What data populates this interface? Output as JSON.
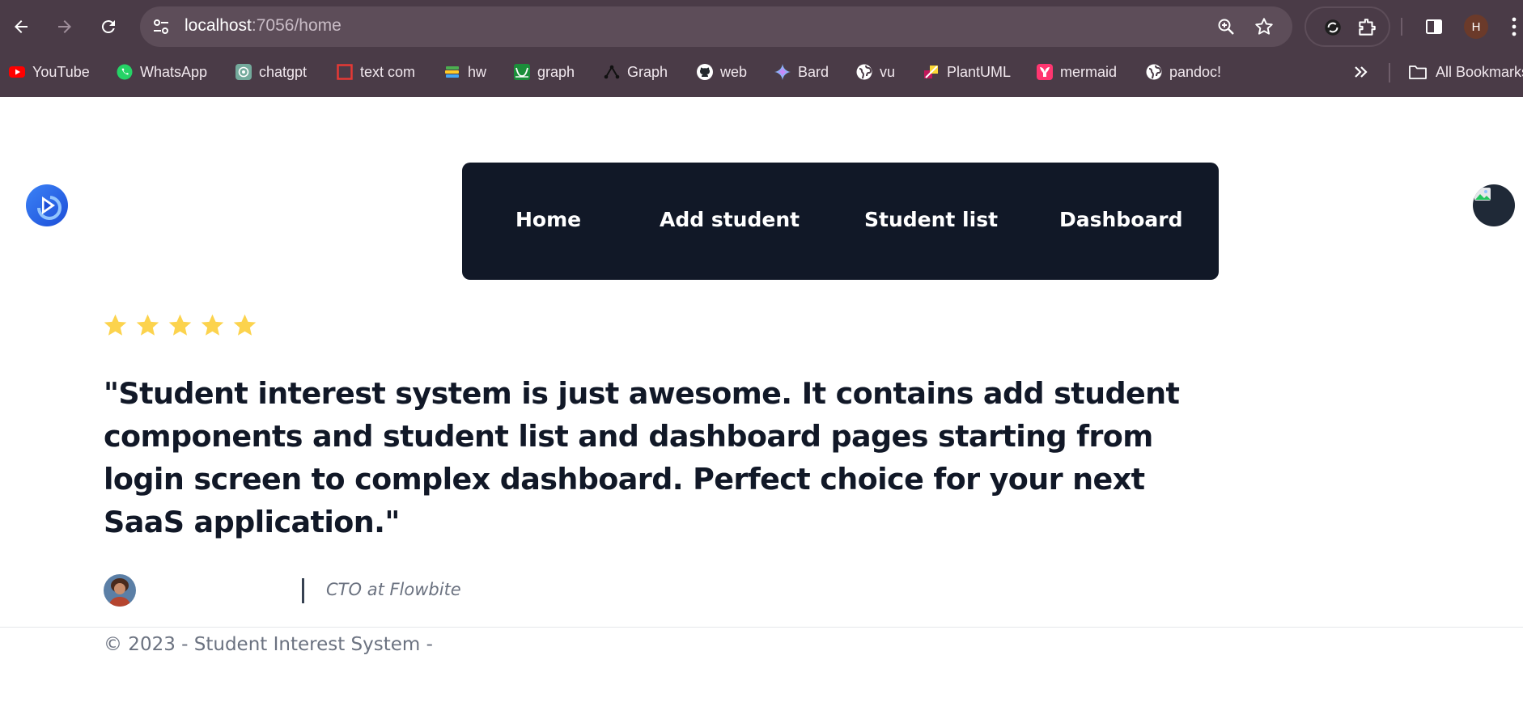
{
  "browser": {
    "url_host": "localhost",
    "url_path": ":7056/home",
    "profile_initial": "H",
    "bookmarks": [
      {
        "label": "YouTube",
        "icon": "youtube-icon"
      },
      {
        "label": "WhatsApp",
        "icon": "whatsapp-icon"
      },
      {
        "label": "chatgpt",
        "icon": "chatgpt-icon"
      },
      {
        "label": "text com",
        "icon": "square-icon"
      },
      {
        "label": "hw",
        "icon": "books-icon"
      },
      {
        "label": "graph",
        "icon": "graph-icon"
      },
      {
        "label": "Graph",
        "icon": "graph-tri-icon"
      },
      {
        "label": "web",
        "icon": "github-icon"
      },
      {
        "label": "Bard",
        "icon": "bard-icon"
      },
      {
        "label": "vu",
        "icon": "globe-icon"
      },
      {
        "label": "PlantUML",
        "icon": "plantuml-icon"
      },
      {
        "label": "mermaid",
        "icon": "mermaid-icon"
      },
      {
        "label": "pandoc!",
        "icon": "globe-icon"
      }
    ],
    "all_bookmarks_label": "All Bookmarks"
  },
  "nav": {
    "items": [
      {
        "label": "Home"
      },
      {
        "label": "Add student"
      },
      {
        "label": "Student list"
      },
      {
        "label": "Dashboard"
      }
    ]
  },
  "testimonial": {
    "rating": 5,
    "quote": "\"Student interest system is just awesome. It contains add student components and student list and dashboard pages starting from login screen to complex dashboard. Perfect choice for your next SaaS application.\"",
    "author_role": "CTO at Flowbite"
  },
  "footer": {
    "text": "© 2023 - Student Interest System -"
  },
  "colors": {
    "chrome_bg": "#4a3b47",
    "navbar_bg": "#111827",
    "star": "#fcd34d",
    "text_dark": "#111827",
    "text_muted": "#6b7280"
  }
}
